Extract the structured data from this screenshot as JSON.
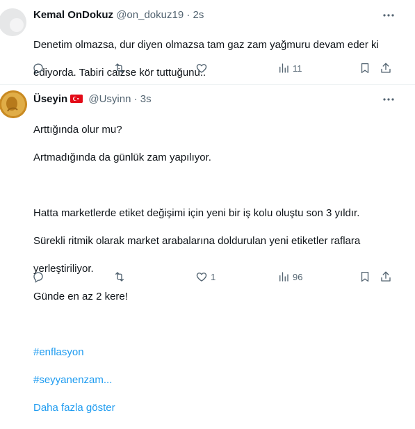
{
  "tweets": [
    {
      "name": "Kemal OnDokuz",
      "handle": "@on_dokuz19",
      "separator": "·",
      "time": "2s",
      "text_lines": [
        "Denetim olmazsa, dur diyen olmazsa tam gaz zam yağmuru devam eder ki",
        "ediyorda. Tabiri caizse kör tuttuğunu.."
      ],
      "reply_count": "",
      "retweet_count": "",
      "like_count": "",
      "view_count": "11"
    },
    {
      "name": "Üseyin",
      "handle": "@Usyinn",
      "separator": "·",
      "time": "3s",
      "text_lines": [
        "Arttığında olur mu?",
        "Artmadığında da günlük zam yapılıyor.",
        "",
        "Hatta marketlerde etiket değişimi için yeni bir iş kolu oluştu son 3 yıldır.",
        "Sürekli ritmik olarak market arabalarına doldurulan yeni etiketler raflara",
        "yerleştiriliyor.",
        "Günde en az 2 kere!",
        ""
      ],
      "hashtags": [
        "#enflasyon",
        "#seyyanenzam..."
      ],
      "show_more": "Daha fazla göster",
      "reply_count": "",
      "retweet_count": "",
      "like_count": "1",
      "view_count": "96"
    }
  ],
  "colors": {
    "link": "#1d9bf0",
    "secondary": "#536471",
    "flag": "#e30a17"
  }
}
